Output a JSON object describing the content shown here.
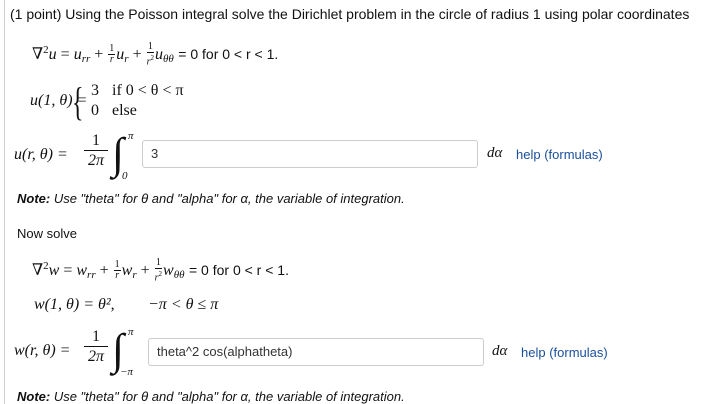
{
  "header": "(1 point) Using the Poisson integral solve the Dirichlet problem in the circle of radius 1 using polar coordinates",
  "problem1": {
    "pde_condition": "= 0 for 0 < r < 1.",
    "bc_lhs": "u(1, θ) =",
    "case1_value": "3",
    "case1_condition": "if 0 < θ < π",
    "case2_value": "0",
    "case2_condition": "else",
    "solution_lhs": "u(r, θ) =",
    "frac_num": "1",
    "frac_den": "2π",
    "int_upper": "π",
    "int_lower": "0",
    "answer_value": "3",
    "dalpha": "dα",
    "help_link": "help (formulas)"
  },
  "note1": {
    "bold": "Note:",
    "text": " Use \"theta\" for θ and \"alpha\" for α, the variable of integration."
  },
  "now_solve": "Now solve",
  "problem2": {
    "pde_condition": "= 0 for 0 < r < 1.",
    "bc_text": "w(1, θ) = θ²,",
    "bc_range": "−π < θ ≤ π",
    "solution_lhs": "w(r, θ) =",
    "frac_num": "1",
    "frac_den": "2π",
    "int_upper": "π",
    "int_lower": "−π",
    "answer_value": "theta^2 cos(alphatheta)",
    "dalpha": "dα",
    "help_link": "help (formulas)"
  },
  "note2": {
    "bold": "Note:",
    "text": " Use \"theta\" for θ and \"alpha\" for α, the variable of integration."
  }
}
